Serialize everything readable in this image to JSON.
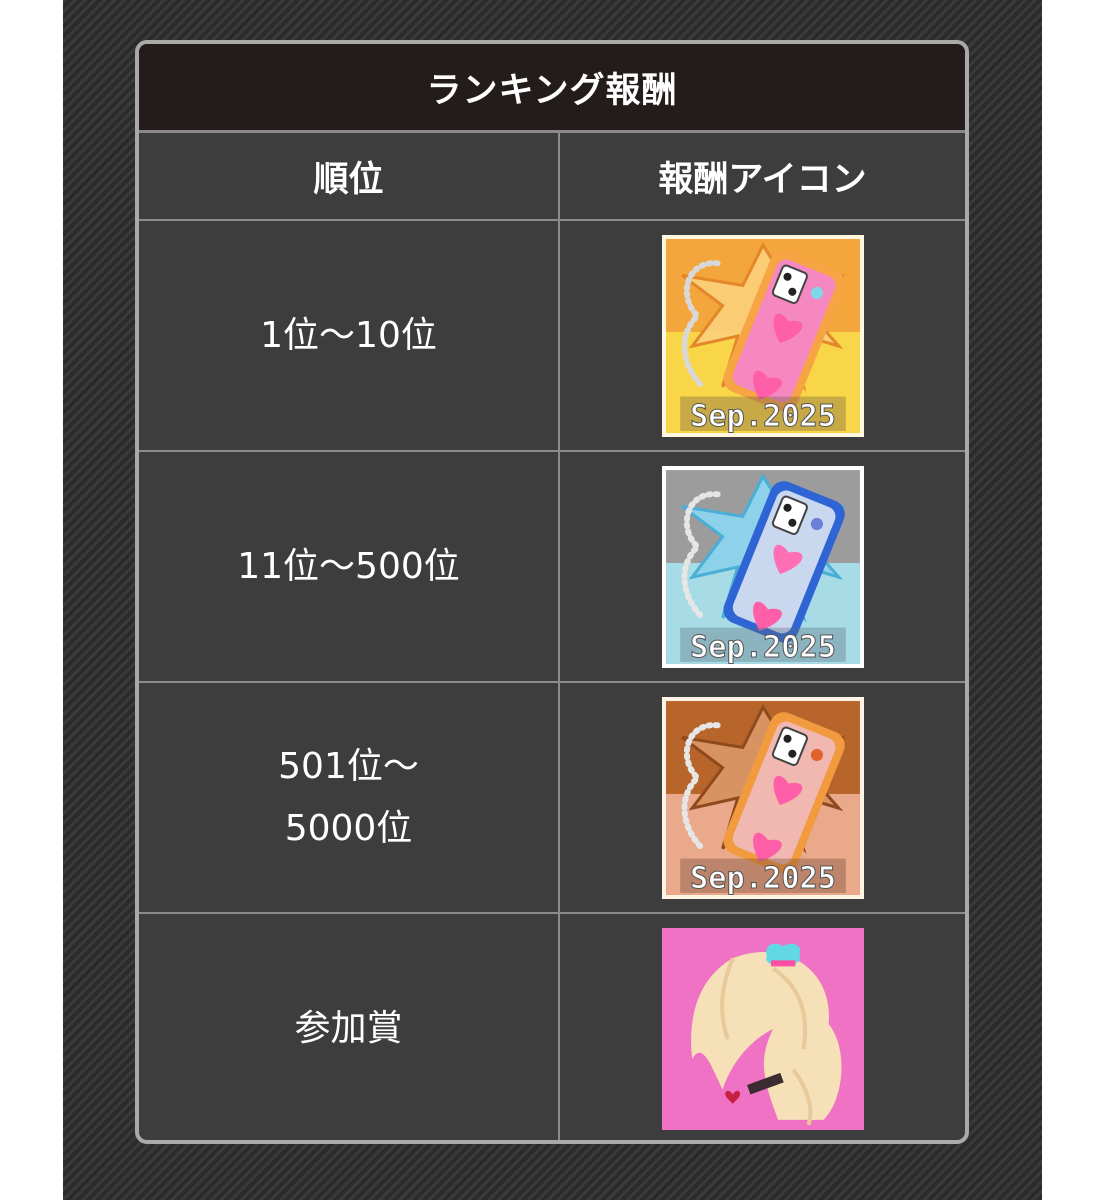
{
  "table": {
    "title": "ランキング報酬",
    "headers": {
      "rank": "順位",
      "icon": "報酬アイコン"
    },
    "rows": [
      {
        "rank": "1位〜10位",
        "icon": "phone-case-icon-gold",
        "icon_caption": "Sep.2025"
      },
      {
        "rank": "11位〜500位",
        "icon": "phone-case-icon-silver",
        "icon_caption": "Sep.2025"
      },
      {
        "rank": "501位〜\n 5000位",
        "icon": "phone-case-icon-bronze",
        "icon_caption": "Sep.2025"
      },
      {
        "rank": "参加賞",
        "icon": "character-silhouette-icon"
      }
    ]
  },
  "colors": {
    "title_bar": "#231c1a",
    "table_bg": "#3d3d3d",
    "border": "#a9a9a9",
    "gold": "#f3a63b",
    "silver": "#a7dbe6",
    "bronze": "#c9773f",
    "participation": "#ef72c4"
  }
}
